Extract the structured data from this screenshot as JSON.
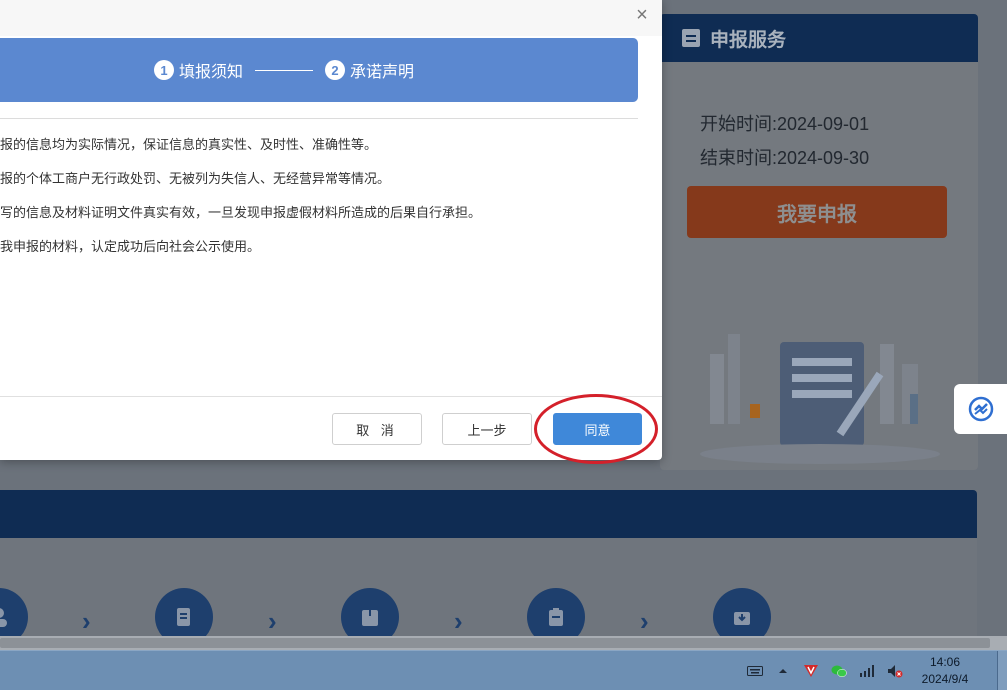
{
  "service": {
    "title": "申报服务",
    "start_time": "开始时间:2024-09-01",
    "end_time": "结束时间:2024-09-30",
    "apply_label": "我要申报"
  },
  "dialog": {
    "close_glyph": "×",
    "steps": [
      {
        "num": "1",
        "label": "填报须知"
      },
      {
        "num": "2",
        "label": "承诺声明"
      }
    ],
    "statements": [
      "报的信息均为实际情况，保证信息的真实性、及时性、准确性等。",
      "报的个体工商户无行政处罚、无被列为失信人、无经营异常等情况。",
      "写的信息及材料证明文件真实有效，一旦发现申报虚假材料所造成的后果自行承担。",
      "我申报的材料，认定成功后向社会公示使用。"
    ],
    "buttons": {
      "cancel": "取 消",
      "prev": "上一步",
      "agree": "同意"
    }
  },
  "taskbar": {
    "time": "14:06",
    "date": "2024/9/4"
  },
  "colors": {
    "steps_bar": "#5b88d0",
    "agree_button": "#3f88d9",
    "highlight_ring": "#d4202a",
    "apply_button": "#85391b"
  }
}
